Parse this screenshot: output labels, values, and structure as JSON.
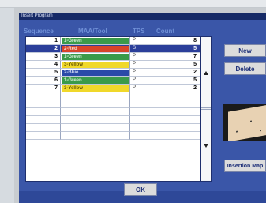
{
  "window": {
    "title": "Insert Program"
  },
  "headers": {
    "sequence": "Sequence",
    "material_tool": "MAA/Tool",
    "tps": "TPS",
    "count": "Count"
  },
  "rows": [
    {
      "seq": "1",
      "material": "1-Green",
      "color": "#3a9a4a",
      "text_color": "#d9f0d9",
      "tps": "P",
      "count": "8",
      "selected": false
    },
    {
      "seq": "2",
      "material": "2-Red",
      "color": "#d8442a",
      "text_color": "#f8d8cc",
      "tps": "S",
      "count": "5",
      "selected": true
    },
    {
      "seq": "3",
      "material": "1-Green",
      "color": "#3a9a4a",
      "text_color": "#d9f0d9",
      "tps": "P",
      "count": "7",
      "selected": false
    },
    {
      "seq": "4",
      "material": "3-Yellow",
      "color": "#f0d82a",
      "text_color": "#6a5a00",
      "tps": "P",
      "count": "5",
      "selected": false
    },
    {
      "seq": "5",
      "material": "2-Blue",
      "color": "#2a4aa8",
      "text_color": "#d4dcf4",
      "tps": "P",
      "count": "2",
      "selected": false
    },
    {
      "seq": "6",
      "material": "1-Green",
      "color": "#3a9a4a",
      "text_color": "#d9f0d9",
      "tps": "P",
      "count": "5",
      "selected": false
    },
    {
      "seq": "7",
      "material": "3-Yellow",
      "color": "#f0d82a",
      "text_color": "#6a5a00",
      "tps": "P",
      "count": "2",
      "selected": false
    }
  ],
  "buttons": {
    "new": "New",
    "delete": "Delete",
    "insertion_map": "Insertion Map",
    "ok": "OK"
  },
  "colors": {
    "window_bg": "#3a56a8",
    "titlebar": "#162a66",
    "header_text": "#6f8fd6",
    "selected_row": "#2b3f9a",
    "button_text": "#1d2f78"
  }
}
